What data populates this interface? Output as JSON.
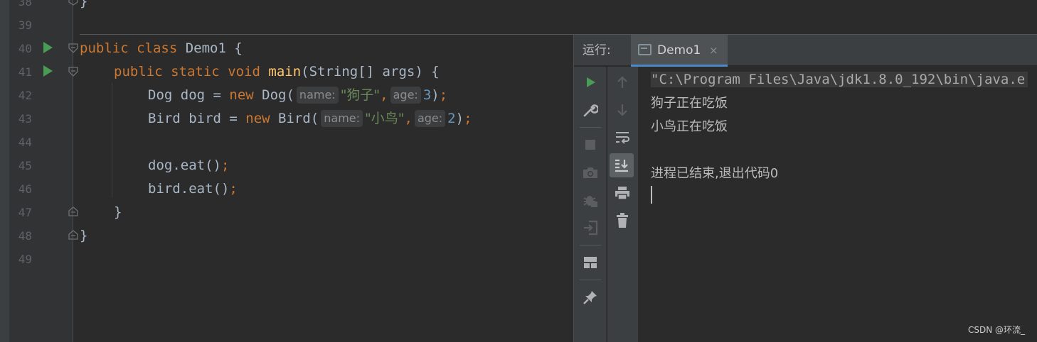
{
  "editor": {
    "line_numbers": [
      "38",
      "39",
      "40",
      "41",
      "42",
      "43",
      "44",
      "45",
      "46",
      "47",
      "48",
      "49"
    ],
    "line38_brace": "}",
    "code": {
      "l40_kw1": "public",
      "l40_kw2": "class",
      "l40_rest": " Demo1 {",
      "l41_kw1": "public",
      "l41_kw2": "static",
      "l41_kw3": "void",
      "l41_fn": "main",
      "l41_rest": "(String[] args) {",
      "l42_a": "Dog dog = ",
      "l42_new": "new",
      "l42_b": " Dog(",
      "l42_hint1": "name:",
      "l42_str": "\"狗子\"",
      "l42_comma": ",",
      "l42_hint2": "age:",
      "l42_num": "3",
      "l42_close": ")",
      "l42_semi": ";",
      "l43_a": "Bird bird = ",
      "l43_new": "new",
      "l43_b": " Bird(",
      "l43_hint1": "name:",
      "l43_str": "\"小鸟\"",
      "l43_comma": ",",
      "l43_hint2": "age:",
      "l43_num": "2",
      "l43_close": ")",
      "l43_semi": ";",
      "l45_a": "dog.eat()",
      "l45_semi": ";",
      "l46_a": "bird.eat()",
      "l46_semi": ";",
      "l47": "}",
      "l48": "}"
    }
  },
  "run_panel": {
    "title": "运行:",
    "tab_label": "Demo1",
    "tab_close": "×",
    "console": {
      "command": "\"C:\\Program Files\\Java\\jdk1.8.0_192\\bin\\java.e",
      "line1": "狗子正在吃饭",
      "line2": "小鸟正在吃饭",
      "exit": "进程已结束,退出代码0"
    },
    "toolbar_left": [
      "run-icon",
      "wrench-icon",
      "stop-icon",
      "camera-icon",
      "bug-icon",
      "login-icon",
      "layout-icon",
      "pin-icon"
    ],
    "toolbar_right": [
      "arrow-up-icon",
      "arrow-down-icon",
      "soft-wrap-icon",
      "scroll-to-end-icon",
      "print-icon",
      "trash-icon"
    ]
  },
  "watermark": "CSDN @环流_",
  "colors": {
    "keyword": "#cc7832",
    "function": "#ffc66d",
    "string": "#6a8759",
    "number": "#6897bb",
    "run_green": "#499c54",
    "tab_underline": "#4a88c7"
  }
}
